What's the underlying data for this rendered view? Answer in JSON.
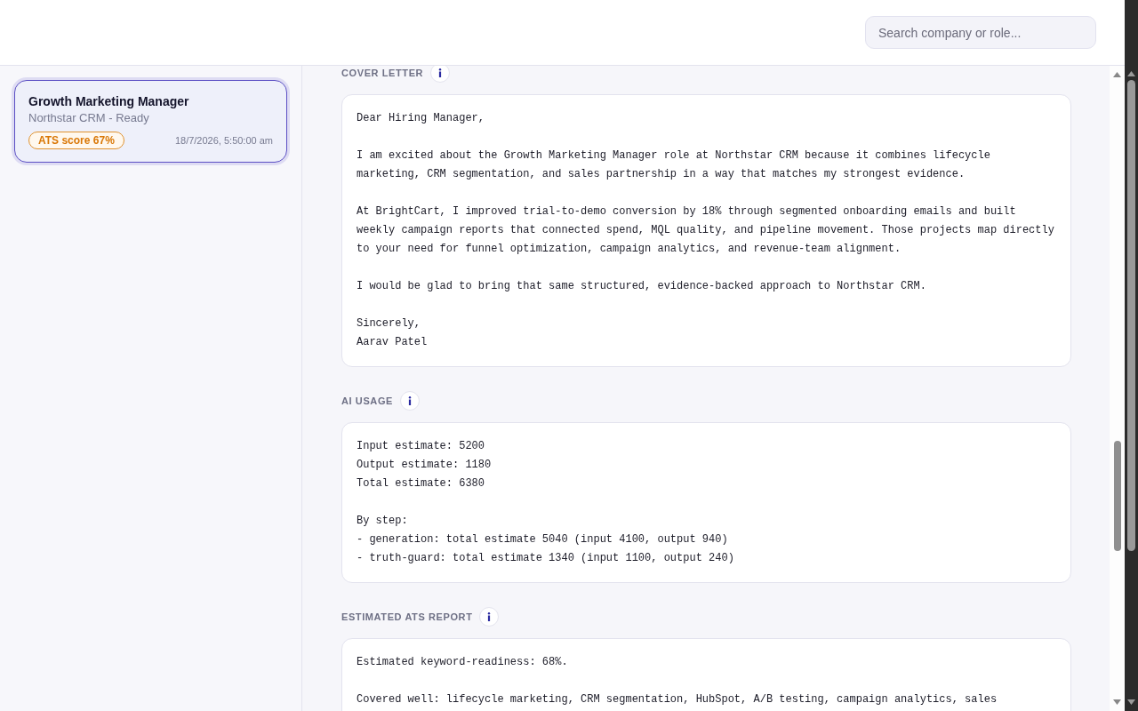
{
  "search": {
    "placeholder": "Search company or role..."
  },
  "applications": [
    {
      "title": "Growth Marketing Manager",
      "subtitle": "Northstar CRM - Ready",
      "score": "ATS score 67%",
      "time": "18/7/2026, 5:50:00 am",
      "selected": true
    }
  ],
  "sections": [
    {
      "title": "COVER LETTER",
      "blocks": [
        [
          "Dear Hiring Manager,"
        ],
        [
          "I am excited about the Growth Marketing Manager role at Northstar CRM because it combines lifecycle marketing, CRM segmentation, and sales partnership in a way that matches my strongest evidence."
        ],
        [
          "At BrightCart, I improved trial-to-demo conversion by 18% through segmented onboarding emails and built weekly campaign reports that connected spend, MQL quality, and pipeline movement. Those projects map directly to your need for funnel optimization, campaign analytics, and revenue-team alignment."
        ],
        [
          "I would be glad to bring that same structured, evidence-backed approach to Northstar CRM."
        ],
        [
          "Sincerely,",
          "Aarav Patel"
        ]
      ]
    },
    {
      "title": "AI USAGE",
      "blocks": [
        [
          "Input estimate: 5200",
          "Output estimate: 1180",
          "Total estimate: 6380"
        ],
        [
          "By step:",
          "- generation: total estimate 5040 (input 4100, output 940)",
          "- truth-guard: total estimate 1340 (input 1100, output 240)"
        ]
      ]
    },
    {
      "title": "ESTIMATED ATS REPORT",
      "blocks": [
        [
          "Estimated keyword-readiness: 68%."
        ],
        [
          "Covered well: lifecycle marketing, CRM segmentation, HubSpot, A/B testing, campaign analytics, sales"
        ]
      ]
    }
  ]
}
